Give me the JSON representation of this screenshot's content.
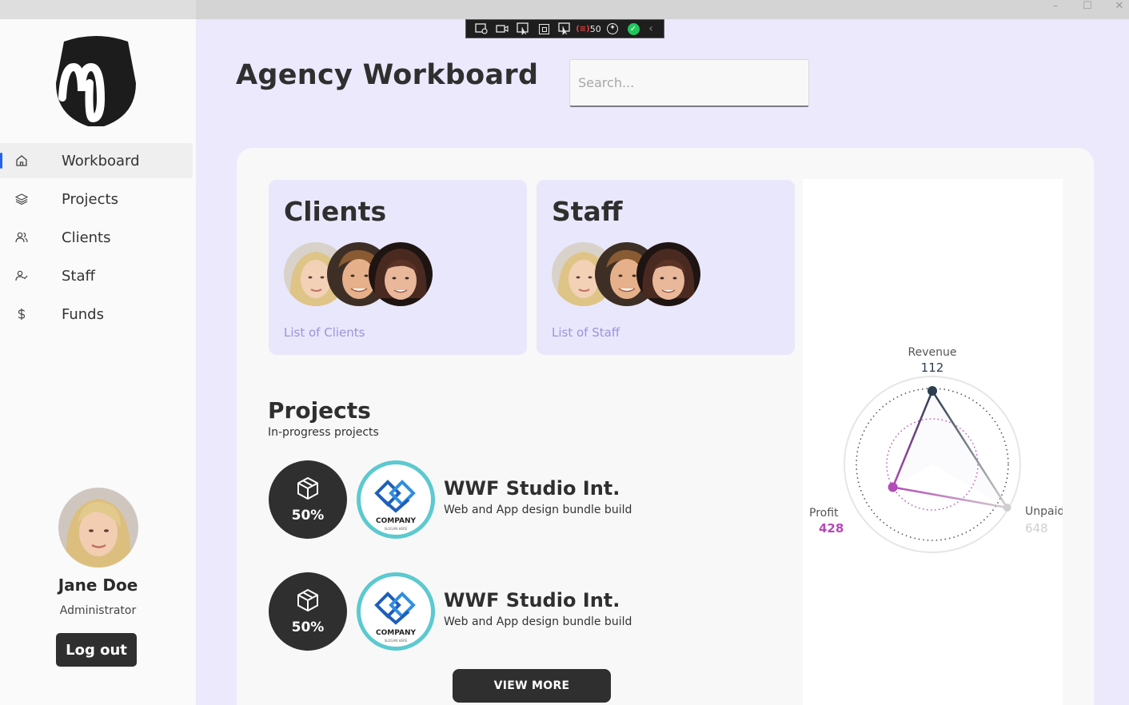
{
  "window": {
    "minimize": "–",
    "maximize": "☐",
    "close": "✕"
  },
  "debug_toolbar": {
    "fps": "50"
  },
  "sidebar": {
    "logo_letter": "M",
    "items": [
      {
        "label": "Workboard",
        "icon": "home-icon"
      },
      {
        "label": "Projects",
        "icon": "layers-icon"
      },
      {
        "label": "Clients",
        "icon": "users-icon"
      },
      {
        "label": "Staff",
        "icon": "user-check-icon"
      },
      {
        "label": "Funds",
        "icon": "dollar-icon"
      }
    ],
    "profile": {
      "name": "Jane Doe",
      "role": "Administrator",
      "logout_label": "Log out"
    }
  },
  "header": {
    "title": "Agency Workboard",
    "search_placeholder": "Search..."
  },
  "cards": {
    "clients": {
      "title": "Clients",
      "link": "List of Clients"
    },
    "staff": {
      "title": "Staff",
      "link": "List of Staff"
    }
  },
  "projects": {
    "title": "Projects",
    "subtitle": "In-progress projects",
    "items": [
      {
        "progress": "50%",
        "name": "WWF Studio Int.",
        "description": "Web and App design bundle build",
        "logo_text": "COMPANY",
        "logo_slogan": "SLOGAN HERE"
      },
      {
        "progress": "50%",
        "name": "WWF Studio Int.",
        "description": "Web and App design bundle build",
        "logo_text": "COMPANY",
        "logo_slogan": "SLOGAN HERE"
      }
    ],
    "view_more_label": "VIEW MORE"
  },
  "chart_data": {
    "type": "radar",
    "axes": [
      "Revenue",
      "Unpaid",
      "Profit"
    ],
    "values": [
      112,
      648,
      428
    ],
    "labels": {
      "revenue": "Revenue",
      "revenue_value": "112",
      "unpaid": "Unpaid",
      "unpaid_value": "648",
      "profit": "Profit",
      "profit_value": "428"
    },
    "colors": {
      "revenue": "#2c3e50",
      "profit": "#b44ab8",
      "unpaid": "#cfcfcf"
    }
  }
}
